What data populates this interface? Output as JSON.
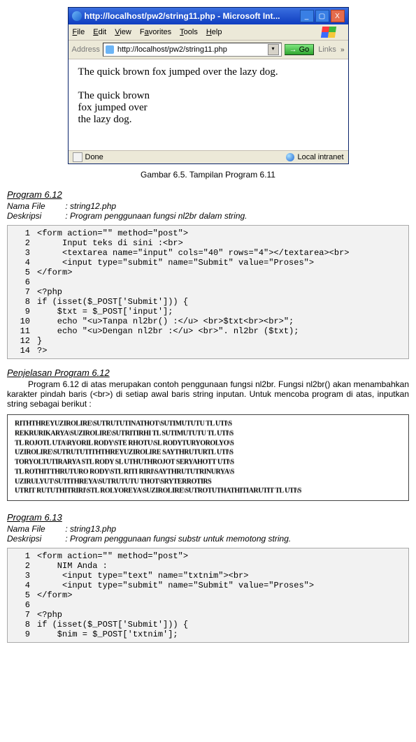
{
  "browser": {
    "title": "http://localhost/pw2/string11.php - Microsoft Int...",
    "menu": {
      "file": "File",
      "edit": "Edit",
      "view": "View",
      "favorites": "Favorites",
      "tools": "Tools",
      "help": "Help"
    },
    "address_label": "Address",
    "url": "http://localhost/pw2/string11.php",
    "go": "Go",
    "links": "Links",
    "content": {
      "line1": "The quick brown fox jumped over the lazy dog.",
      "line2": "The quick brown",
      "line3": "fox jumped over",
      "line4": "the lazy dog."
    },
    "status_done": "Done",
    "status_zone": "Local intranet"
  },
  "figure_caption": "Gambar 6.5. Tampilan Program 6.11",
  "program612": {
    "heading": "Program 6.12",
    "file_label": "Nama File",
    "file_value": ": string12.php",
    "desc_label": "Deskripsi",
    "desc_value": ": Program penggunaan fungsi nl2br dalam string.",
    "code": [
      {
        "n": "1",
        "t": "<form action=\"\" method=\"post\">"
      },
      {
        "n": "2",
        "t": "     Input teks di sini :<br>"
      },
      {
        "n": "3",
        "t": "     <textarea name=\"input\" cols=\"40\" rows=\"4\"></textarea><br>"
      },
      {
        "n": "4",
        "t": "     <input type=\"submit\" name=\"Submit\" value=\"Proses\">"
      },
      {
        "n": "5",
        "t": "</form>"
      },
      {
        "n": "6",
        "t": ""
      },
      {
        "n": "7",
        "t": "<?php"
      },
      {
        "n": "8",
        "t": "if (isset($_POST['Submit'])) {"
      },
      {
        "n": "9",
        "t": "    $txt = $_POST['input'];"
      },
      {
        "n": "10",
        "t": "    echo \"<u>Tanpa nl2br() :</u> <br>$txt<br><br>\";"
      },
      {
        "n": "11",
        "t": "    echo \"<u>Dengan nl2br :</u> <br>\". nl2br ($txt);"
      },
      {
        "n": "12",
        "t": "}"
      },
      {
        "n": "14",
        "t": "?>"
      }
    ]
  },
  "explanation612": {
    "heading": "Penjelasan Program 6.12",
    "para": "Program 6.12 di atas merupakan contoh penggunaan fungsi nl2br. Fungsi nl2br() akan menambahkan karakter pindah baris (<br>) di setiap awal baris string inputan. Untuk mencoba program di atas, inputkan string sebagai berikut :"
  },
  "program613": {
    "heading": "Program 6.13",
    "file_label": "Nama File",
    "file_value": ": string13.php",
    "desc_label": "Deskripsi",
    "desc_value": ": Program penggunaan fungsi substr untuk memotong string.",
    "code": [
      {
        "n": "1",
        "t": "<form action=\"\" method=\"post\">"
      },
      {
        "n": "2",
        "t": "    NIM Anda :"
      },
      {
        "n": "3",
        "t": "     <input type=\"text\" name=\"txtnim\"><br>"
      },
      {
        "n": "4",
        "t": "     <input type=\"submit\" name=\"Submit\" value=\"Proses\">"
      },
      {
        "n": "5",
        "t": "</form>"
      },
      {
        "n": "6",
        "t": ""
      },
      {
        "n": "7",
        "t": "<?php"
      },
      {
        "n": "8",
        "t": "if (isset($_POST['Submit'])) {"
      },
      {
        "n": "9",
        "t": "    $nim = $_POST['txtnim'];"
      }
    ]
  }
}
